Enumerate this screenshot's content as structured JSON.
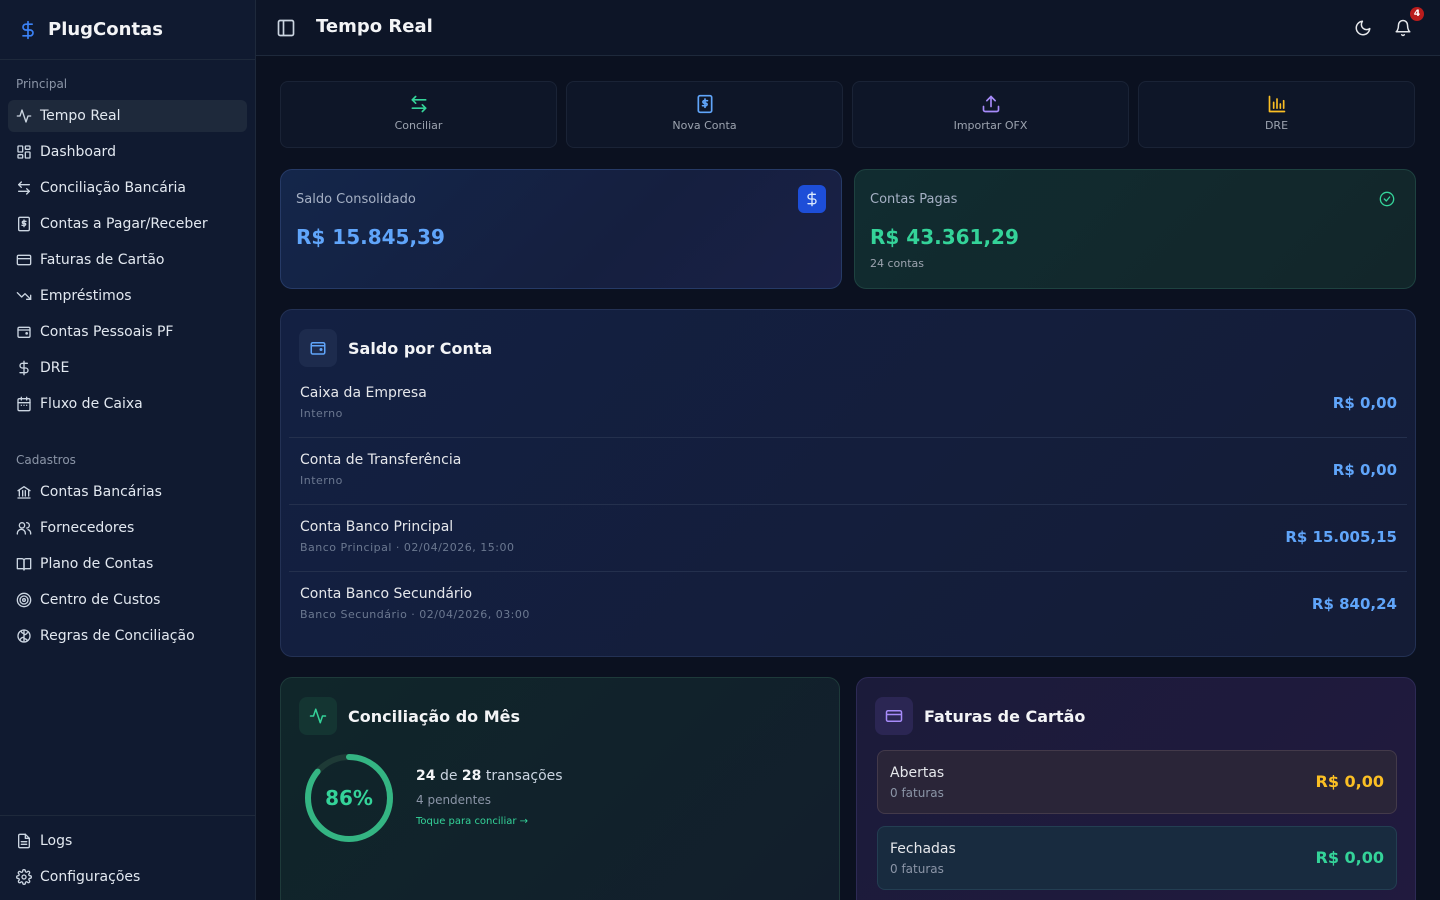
{
  "app": {
    "name": "PlugContas"
  },
  "header": {
    "title": "Tempo Real",
    "notifications_count": "4"
  },
  "sidebar": {
    "principal_label": "Principal",
    "principal_items": [
      {
        "label": "Tempo Real",
        "icon": "activity-icon",
        "active": true
      },
      {
        "label": "Dashboard",
        "icon": "dashboard-icon"
      },
      {
        "label": "Conciliação Bancária",
        "icon": "arrows-exchange-icon"
      },
      {
        "label": "Contas a Pagar/Receber",
        "icon": "receipt-icon"
      },
      {
        "label": "Faturas de Cartão",
        "icon": "credit-card-icon"
      },
      {
        "label": "Empréstimos",
        "icon": "trending-down-icon"
      },
      {
        "label": "Contas Pessoais PF",
        "icon": "wallet-icon"
      },
      {
        "label": "DRE",
        "icon": "dollar-icon"
      },
      {
        "label": "Fluxo de Caixa",
        "icon": "calendar-icon"
      }
    ],
    "cadastros_label": "Cadastros",
    "cadastros_items": [
      {
        "label": "Contas Bancárias",
        "icon": "bank-icon"
      },
      {
        "label": "Fornecedores",
        "icon": "users-icon"
      },
      {
        "label": "Plano de Contas",
        "icon": "book-icon"
      },
      {
        "label": "Centro de Custos",
        "icon": "target-icon"
      },
      {
        "label": "Regras de Conciliação",
        "icon": "brain-icon"
      }
    ],
    "footer_items": [
      {
        "label": "Logs",
        "icon": "file-text-icon"
      },
      {
        "label": "Configurações",
        "icon": "gear-icon"
      }
    ]
  },
  "quick_actions": [
    {
      "label": "Conciliar",
      "icon": "arrows-exchange-icon",
      "color": "#34d399"
    },
    {
      "label": "Nova Conta",
      "icon": "receipt-icon",
      "color": "#60a5fa"
    },
    {
      "label": "Importar OFX",
      "icon": "upload-icon",
      "color": "#a78bfa"
    },
    {
      "label": "DRE",
      "icon": "bar-chart-icon",
      "color": "#fbbf24"
    }
  ],
  "stats": {
    "saldo": {
      "label": "Saldo Consolidado",
      "value": "R$ 15.845,39",
      "color": "#60a5fa"
    },
    "pagas": {
      "label": "Contas Pagas",
      "value": "R$ 43.361,29",
      "sub": "24 contas",
      "color": "#34d399"
    }
  },
  "saldo_por_conta": {
    "title": "Saldo por Conta",
    "rows": [
      {
        "name": "Caixa da Empresa",
        "sub": "Interno",
        "value": "R$ 0,00"
      },
      {
        "name": "Conta de Transferência",
        "sub": "Interno",
        "value": "R$ 0,00"
      },
      {
        "name": "Conta Banco Principal",
        "sub": "Banco Principal · 02/04/2026, 15:00",
        "value": "R$ 15.005,15"
      },
      {
        "name": "Conta Banco Secundário",
        "sub": "Banco Secundário · 02/04/2026, 03:00",
        "value": "R$ 840,24"
      }
    ]
  },
  "conciliacao": {
    "title": "Conciliação do Mês",
    "percent_label": "86%",
    "percent": 0.86,
    "done": "24",
    "of_word": "de",
    "total": "28",
    "transactions_word": "transações",
    "pending": "4 pendentes",
    "link": "Toque para conciliar →"
  },
  "faturas": {
    "title": "Faturas de Cartão",
    "abertas": {
      "label": "Abertas",
      "sub": "0 faturas",
      "value": "R$ 0,00",
      "color": "#fbbf24"
    },
    "fechadas": {
      "label": "Fechadas",
      "sub": "0 faturas",
      "value": "R$ 0,00",
      "color": "#34d399"
    }
  }
}
